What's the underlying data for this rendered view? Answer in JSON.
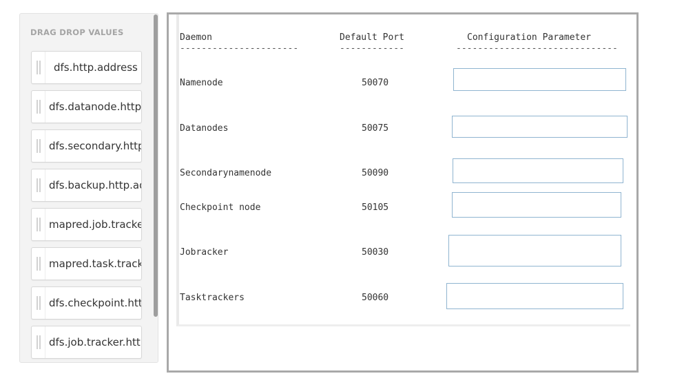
{
  "sidebar": {
    "title": "DRAG DROP VALUES",
    "items": [
      {
        "label": "dfs.http.address"
      },
      {
        "label": "dfs.datanode.http.address"
      },
      {
        "label": "dfs.secondary.http.address"
      },
      {
        "label": "dfs.backup.http.address"
      },
      {
        "label": "mapred.job.tracker.http.address"
      },
      {
        "label": "mapred.task.tracker.http.address"
      },
      {
        "label": "dfs.checkpoint.http.address"
      },
      {
        "label": "dfs.job.tracker.http.address"
      }
    ]
  },
  "table": {
    "headers": {
      "daemon": "Daemon",
      "port": "Default Port",
      "param": "Configuration Parameter"
    },
    "dashes": {
      "daemon": "----------------------",
      "port": "------------",
      "param": "------------------------------"
    },
    "rows": [
      {
        "daemon": "Namenode",
        "port": "50070"
      },
      {
        "daemon": "Datanodes",
        "port": "50075"
      },
      {
        "daemon": "Secondarynamenode",
        "port": "50090"
      },
      {
        "daemon": "Checkpoint node",
        "port": "50105"
      },
      {
        "daemon": "Jobracker",
        "port": "50030"
      },
      {
        "daemon": "Tasktrackers",
        "port": "50060"
      }
    ]
  }
}
